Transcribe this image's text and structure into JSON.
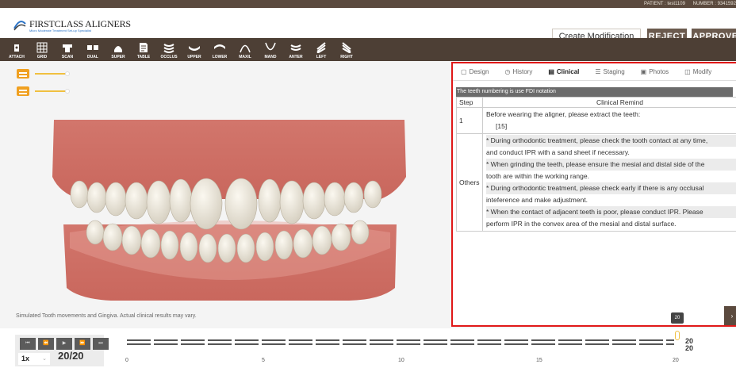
{
  "topbar": {
    "patient": "PATIENT : test1109",
    "number": "NUMBER : 9341592"
  },
  "header": {
    "brand": "FIRSTCLASS ALIGNERS",
    "tagline": "Micro Moderate Treatment Set-up Specialist",
    "create_modification": "Create Modification",
    "reject": "REJECT",
    "approve": "APPROVE"
  },
  "toolbar": {
    "items": [
      {
        "label": "ATTACH",
        "icon": "attach-icon"
      },
      {
        "label": "GRID",
        "icon": "grid-icon"
      },
      {
        "label": "SCAN",
        "icon": "scan-icon"
      },
      {
        "label": "DUAL",
        "icon": "dual-icon"
      },
      {
        "label": "SUPER",
        "icon": "super-icon"
      },
      {
        "label": "TABLE",
        "icon": "table-icon"
      },
      {
        "label": "OCCLUS",
        "icon": "occlusion-icon"
      },
      {
        "label": "UPPER",
        "icon": "upper-icon"
      },
      {
        "label": "LOWER",
        "icon": "lower-icon"
      },
      {
        "label": "MAXIL",
        "icon": "maxillary-icon"
      },
      {
        "label": "MAND",
        "icon": "mandibular-icon"
      },
      {
        "label": "ANTER",
        "icon": "anterior-icon"
      },
      {
        "label": "LEFT",
        "icon": "left-view-icon"
      },
      {
        "label": "RIGHT",
        "icon": "right-view-icon"
      }
    ]
  },
  "viewer": {
    "disclaimer": "Simulated Tooth movements and Gingiva. Actual clinical results may vary.",
    "accent": "#f0a020"
  },
  "panel": {
    "tabs": [
      {
        "label": "Design",
        "icon": "▢",
        "active": false
      },
      {
        "label": "History",
        "icon": "◷",
        "active": false
      },
      {
        "label": "Clinical",
        "icon": "▤",
        "active": true
      },
      {
        "label": "Staging",
        "icon": "☰",
        "active": false
      },
      {
        "label": "Photos",
        "icon": "▣",
        "active": false
      },
      {
        "label": "Modify",
        "icon": "◫",
        "active": false
      }
    ],
    "notation": "The teeth numbering is use FDI notation",
    "headers": {
      "step": "Step",
      "remind": "Clinical Remind"
    },
    "rows": [
      {
        "step": "1",
        "lines": [
          "Before wearing the aligner, please extract the teeth:",
          "[15]"
        ]
      },
      {
        "step": "Others",
        "lines": [
          "* During orthodontic treatment, please check the tooth contact at any time,",
          "and conduct IPR with a sand sheet if necessary.",
          "* When grinding the teeth, please ensure the mesial and distal side of the",
          "tooth are within the working range.",
          "* During orthodontic treatment, please check early if there is any occlusal",
          "inteference and make adjustment.",
          "* When the contact of adjacent teeth is poor, please conduct IPR. Please",
          "perform IPR in the convex area of the mesial and distal surface."
        ]
      }
    ],
    "page_badge": "20",
    "highlight_color": "#e01818"
  },
  "playback": {
    "speed": "1x",
    "frame": "20/20",
    "upper_end": "20",
    "lower_end": "20",
    "ticks": [
      "0",
      "5",
      "10",
      "15",
      "20"
    ]
  }
}
